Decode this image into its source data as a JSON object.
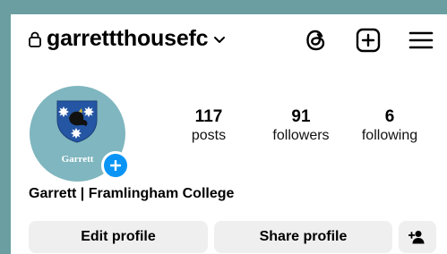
{
  "header": {
    "username": "garrettthousefc"
  },
  "profile": {
    "avatar_text": "Garrett",
    "display_name": "Garrett | Framlingham College",
    "stats": [
      {
        "value": "117",
        "label": "posts"
      },
      {
        "value": "91",
        "label": "followers"
      },
      {
        "value": "6",
        "label": "following"
      }
    ]
  },
  "actions": {
    "edit_label": "Edit profile",
    "share_label": "Share profile"
  },
  "icons": {
    "lock": "lock-icon",
    "chevron": "chevron-down-icon",
    "threads": "threads-icon",
    "create": "plus-square-icon",
    "menu": "hamburger-menu-icon",
    "add_story": "plus-icon",
    "suggest": "add-person-icon"
  },
  "colors": {
    "background": "#6a9ea0",
    "avatar_bg": "#7fb6bf",
    "accent": "#0a95f6",
    "button_bg": "#efefef"
  }
}
